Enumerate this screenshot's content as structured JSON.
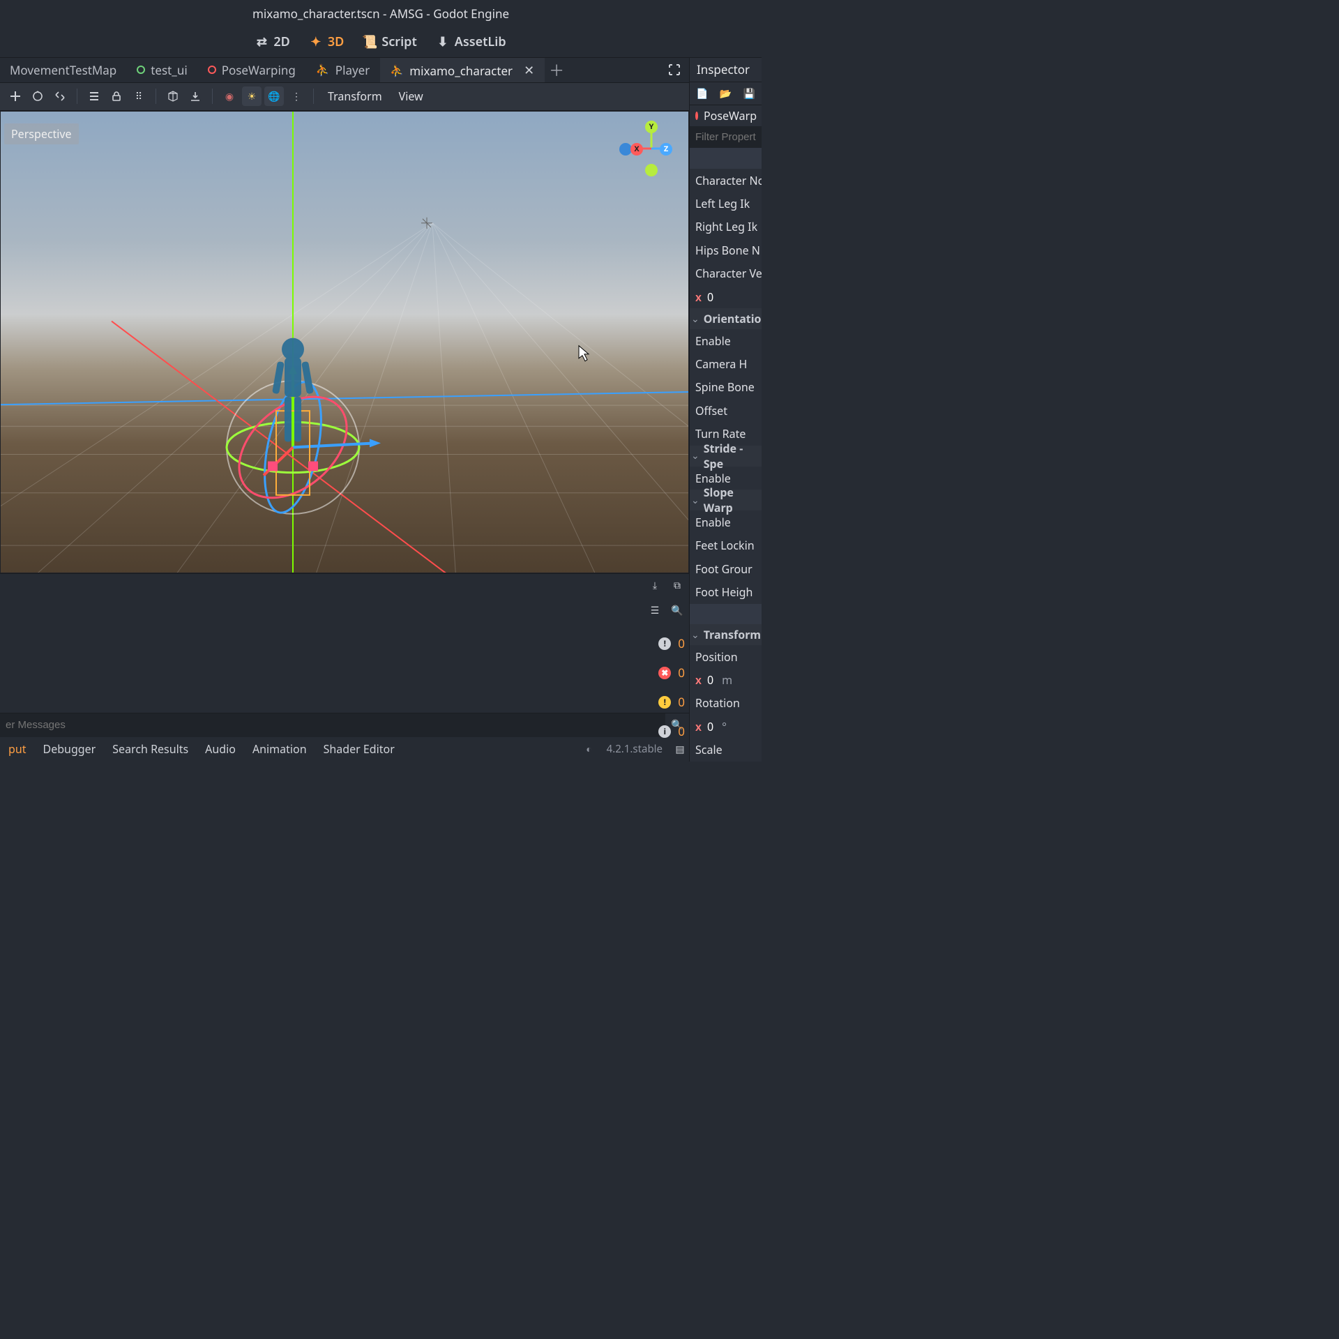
{
  "titlebar": "mixamo_character.tscn - AMSG - Godot Engine",
  "workspace": {
    "tabs": [
      {
        "icon": "arrows-2d",
        "label": "2D"
      },
      {
        "icon": "arrows-3d",
        "label": "3D"
      },
      {
        "icon": "script-icon",
        "label": "Script"
      },
      {
        "icon": "download-icon",
        "label": "AssetLib"
      }
    ],
    "active": 1
  },
  "scene_tabs": {
    "items": [
      {
        "kind": "scene",
        "label": "MovementTestMap"
      },
      {
        "kind": "node-ring",
        "color": "#6fd27a",
        "label": "test_ui"
      },
      {
        "kind": "node-ring",
        "color": "#ff5a5a",
        "label": "PoseWarping"
      },
      {
        "kind": "char",
        "label": "Player"
      },
      {
        "kind": "char",
        "label": "mixamo_character",
        "active": true,
        "closable": true
      }
    ]
  },
  "toolbar": {
    "transform": "Transform",
    "view": "View"
  },
  "viewport": {
    "projection": "Perspective",
    "axis": {
      "x": "X",
      "y": "Y",
      "z": "Z"
    }
  },
  "inspector": {
    "title": "Inspector",
    "node": "PoseWarp",
    "filter_placeholder": "Filter Properti",
    "props": {
      "character_node": "Character No",
      "left_leg_ik": "Left Leg Ik",
      "right_leg_ik": "Right Leg Ik",
      "hips_bone": "Hips Bone N",
      "character_ve": "Character Ve",
      "x0": "0",
      "section_orientation": "Orientation",
      "enable1": "Enable",
      "camera_h": "Camera H",
      "spine_bone": "Spine Bone",
      "offset": "Offset",
      "turn_rate": "Turn Rate",
      "section_stride": "Stride - Spe",
      "enable2": "Enable",
      "section_slope": "Slope Warp",
      "enable3": "Enable",
      "feet_locking": "Feet Lockin",
      "foot_ground": "Foot Grour",
      "foot_height": "Foot Heigh",
      "section_transform": "Transform",
      "position": "Position",
      "pos_x": "0",
      "pos_unit": "m",
      "rotation": "Rotation",
      "rot_x": "0",
      "rot_unit": "°",
      "scale": "Scale"
    }
  },
  "stats": {
    "err_white": "0",
    "err_red": "0",
    "warn": "0",
    "info": "0"
  },
  "bottom": {
    "filter_placeholder": "er Messages",
    "tabs": [
      "put",
      "Debugger",
      "Search Results",
      "Audio",
      "Animation",
      "Shader Editor"
    ],
    "active": 0,
    "version": "4.2.1.stable"
  }
}
